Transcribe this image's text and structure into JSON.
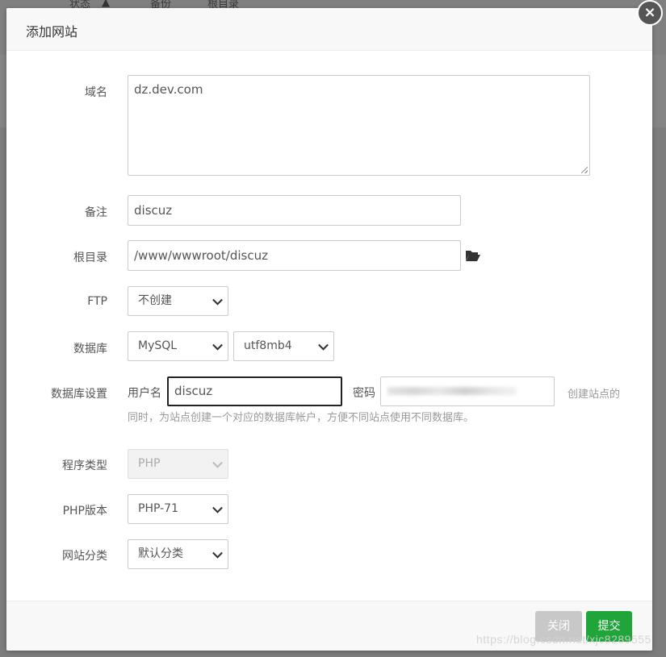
{
  "background": {
    "columns": [
      "状态",
      "备份",
      "根目录"
    ]
  },
  "dialog": {
    "title": "添加网站",
    "close_icon": "×"
  },
  "form": {
    "domain": {
      "label": "域名",
      "value": "dz.dev.com"
    },
    "remark": {
      "label": "备注",
      "value": "discuz"
    },
    "root": {
      "label": "根目录",
      "value": "/www/wwwroot/discuz",
      "icon": "folder-open-icon"
    },
    "ftp": {
      "label": "FTP",
      "selected": "不创建"
    },
    "database": {
      "label": "数据库",
      "type": "MySQL",
      "charset": "utf8mb4"
    },
    "db_settings": {
      "label": "数据库设置",
      "user_label": "用户名",
      "user_value": "discuz",
      "password_label": "密码",
      "hint_line1": "创建站点的",
      "hint_line2": "同时，为站点创建一个对应的数据库帐户，方便不同站点使用不同数据库。"
    },
    "program_type": {
      "label": "程序类型",
      "selected": "PHP"
    },
    "php_version": {
      "label": "PHP版本",
      "selected": "PHP-71"
    },
    "site_category": {
      "label": "网站分类",
      "selected": "默认分类"
    }
  },
  "footer": {
    "close_label": "关闭",
    "submit_label": "提交"
  },
  "watermark": "https://blog.csdn.net/xjc8289555",
  "colors": {
    "submit": "#20a53a",
    "close": "#c8c8c8",
    "overlay": "#7d7d7d"
  }
}
